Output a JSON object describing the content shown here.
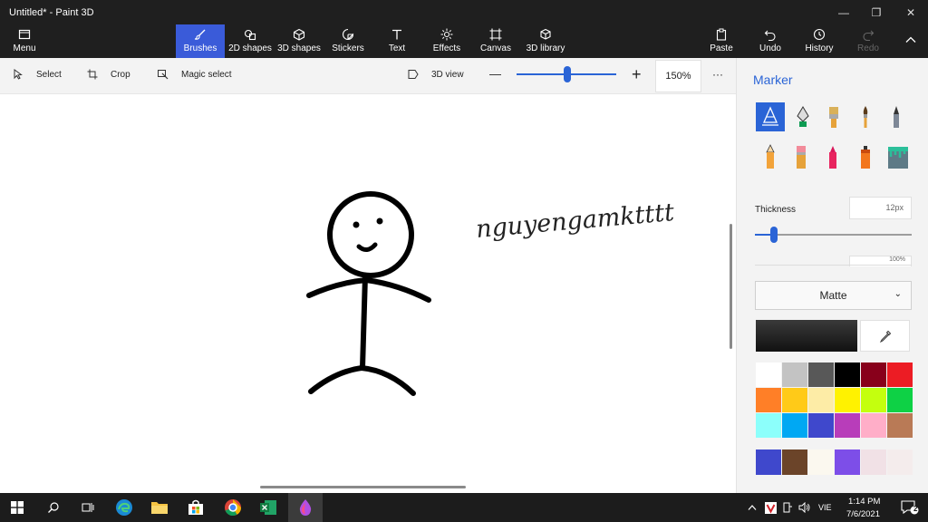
{
  "window": {
    "title": "Untitled* - Paint 3D",
    "controls": [
      "—",
      "❐",
      "✕"
    ]
  },
  "ribbon": {
    "menu": "Menu",
    "tabs": [
      "Brushes",
      "2D shapes",
      "3D shapes",
      "Stickers",
      "Text",
      "Effects",
      "Canvas",
      "3D library"
    ],
    "active_tab": "Brushes",
    "right": [
      "Paste",
      "Undo",
      "History",
      "Redo"
    ]
  },
  "toolbar": {
    "select": "Select",
    "crop": "Crop",
    "magic_select": "Magic select",
    "view3d": "3D view",
    "zoom_minus": "—",
    "zoom_plus": "+",
    "zoom_level": "150%",
    "zoom_fraction": 0.5,
    "more": "···"
  },
  "canvas": {
    "signature": "nguyengamktttt"
  },
  "panel": {
    "title": "Marker",
    "thickness_label": "Thickness",
    "thickness_value": "12px",
    "opacity_value": "100%",
    "finish": "Matte",
    "chevron": "⌄",
    "tools": [
      "marker-icon",
      "calligraphy-pen-icon",
      "oil-brush-icon",
      "watercolor-icon",
      "pixel-pen-icon",
      "pencil-icon",
      "eraser-icon",
      "crayon-icon",
      "spray-can-icon",
      "fill-bucket-icon"
    ],
    "current_color": "#1a1a1a",
    "palette": [
      "#ffffff",
      "#c3c3c3",
      "#585858",
      "#000000",
      "#88001b",
      "#ec1c24",
      "#ff7f27",
      "#ffca18",
      "#fdeca6",
      "#fff200",
      "#c4ff0e",
      "#0ed145",
      "#8cfffb",
      "#00a8f3",
      "#3f48cc",
      "#b83dba",
      "#ffaec8",
      "#b97a56"
    ],
    "custom_palette": [
      "#3f48cc",
      "#6b4429",
      "#fbf8ef",
      "#7d4ee8",
      "#f1e1e6",
      "#f4ecec"
    ]
  },
  "taskbar": {
    "time": "1:14 PM",
    "date": "7/6/2021",
    "lang": "VIE",
    "notifications": "2",
    "apps": [
      "start-icon",
      "search-icon",
      "task-view-icon",
      "edge-icon",
      "file-explorer-icon",
      "store-icon",
      "chrome-icon",
      "excel-icon",
      "paint3d-icon"
    ]
  }
}
